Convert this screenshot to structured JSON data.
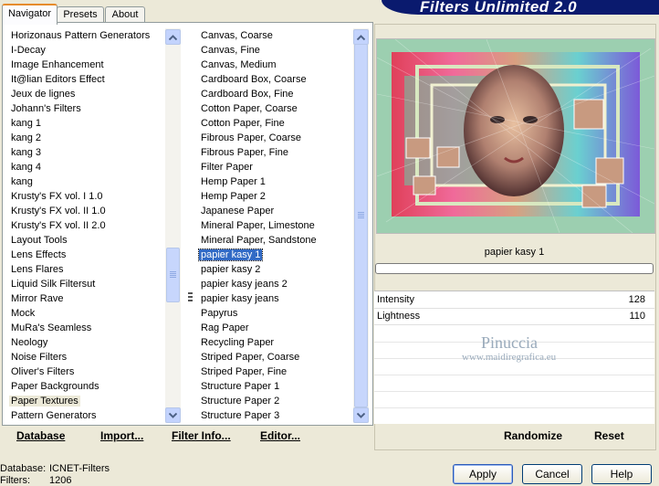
{
  "title": "Filters Unlimited 2.0",
  "tabs": [
    {
      "label": "Navigator"
    },
    {
      "label": "Presets"
    },
    {
      "label": "About"
    }
  ],
  "categories": [
    "Horizonaus Pattern Generators",
    "I-Decay",
    "Image Enhancement",
    "It@lian Editors Effect",
    "Jeux de lignes",
    "Johann's Filters",
    "kang 1",
    "kang 2",
    "kang 3",
    "kang 4",
    "kang",
    "Krusty's FX vol. I 1.0",
    "Krusty's FX vol. II 1.0",
    "Krusty's FX vol. II 2.0",
    "Layout Tools",
    "Lens Effects",
    "Lens Flares",
    "Liquid Silk Filtersut",
    "Mirror Rave",
    "Mock",
    "MuRa's Seamless",
    "Neology",
    "Noise Filters",
    "Oliver's Filters",
    "Paper Backgrounds",
    "Paper Textures",
    "Pattern Generators"
  ],
  "selected_category": "Paper Textures",
  "filters": [
    "Canvas, Coarse",
    "Canvas, Fine",
    "Canvas, Medium",
    "Cardboard Box, Coarse",
    "Cardboard Box, Fine",
    "Cotton Paper, Coarse",
    "Cotton Paper, Fine",
    "Fibrous Paper, Coarse",
    "Fibrous Paper, Fine",
    "Filter Paper",
    "Hemp Paper 1",
    "Hemp Paper 2",
    "Japanese Paper",
    "Mineral Paper, Limestone",
    "Mineral Paper, Sandstone",
    "papier kasy 1",
    "papier kasy 2",
    "papier kasy jeans 2",
    "papier kasy jeans",
    "Papyrus",
    "Rag Paper",
    "Recycling Paper",
    "Striped Paper, Coarse",
    "Striped Paper, Fine",
    "Structure Paper 1",
    "Structure Paper 2",
    "Structure Paper 3"
  ],
  "selected_filter": "papier kasy 1",
  "bottom_links": {
    "database": "Database",
    "import": "Import...",
    "filter_info": "Filter Info...",
    "editor": "Editor..."
  },
  "preview": {
    "filter_name": "papier kasy 1",
    "params": [
      {
        "label": "Intensity",
        "value": "128"
      },
      {
        "label": "Lightness",
        "value": "110"
      }
    ],
    "watermark_line1": "Pinuccia",
    "watermark_line2": "www.maidiregrafica.eu"
  },
  "actions": {
    "randomize": "Randomize",
    "reset": "Reset",
    "apply": "Apply",
    "cancel": "Cancel",
    "help": "Help"
  },
  "status": {
    "database_label": "Database:",
    "database_value": "ICNET-Filters",
    "filters_label": "Filters:",
    "filters_value": "1206"
  },
  "colors": {
    "banner": "#0a1a6e",
    "selection": "#316ac5",
    "tab_accent": "#e68b2c"
  }
}
